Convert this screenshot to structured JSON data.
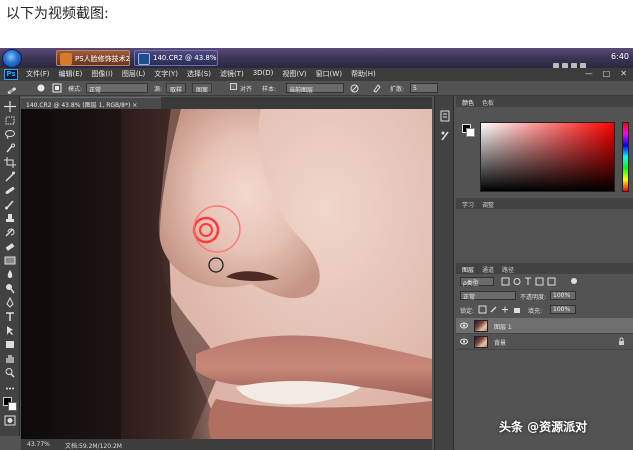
{
  "caption": "以下为视频截图:",
  "taskbar": {
    "tasks": [
      {
        "label": "PS人脸修饰技术2"
      },
      {
        "label": "140.CR2 @ 43.8%"
      }
    ],
    "clock": "6:40"
  },
  "menubar": {
    "logo": "Ps",
    "items": [
      "文件(F)",
      "编辑(E)",
      "图像(I)",
      "图层(L)",
      "文字(Y)",
      "选择(S)",
      "滤镜(T)",
      "3D(D)",
      "视图(V)",
      "窗口(W)",
      "帮助(H)"
    ],
    "controls": [
      "—",
      "□",
      "✕"
    ]
  },
  "options": {
    "mode_label": "模式:",
    "mode_value": "正常",
    "source_label": "源:",
    "sampled_button": "取样",
    "pattern_button": "图案",
    "aligned_label": "对齐",
    "sample_label": "样本:",
    "sample_value": "当前图层",
    "diffusion_label": "扩散:",
    "diffusion_value": "5"
  },
  "document": {
    "tab_title": "140.CR2 @ 43.8% (图层 1, RGB/8*) ×",
    "zoom": "43.77%",
    "doc_info": "文档:59.2M/120.2M"
  },
  "color_panel": {
    "tabs": [
      "颜色",
      "色板"
    ]
  },
  "adjust_panel": {
    "tabs": [
      "学习",
      "调整"
    ]
  },
  "layers_panel": {
    "tabs": [
      "图层",
      "通道",
      "路径"
    ],
    "filter_label": "ρ类型",
    "blend_mode": "正常",
    "opacity_label": "不透明度:",
    "opacity_value": "100%",
    "lock_label": "锁定:",
    "fill_label": "填充:",
    "fill_value": "100%",
    "layers": [
      {
        "name": "图层 1",
        "selected": true,
        "locked": false
      },
      {
        "name": "背景",
        "selected": false,
        "locked": true
      }
    ]
  },
  "watermark": "头条 @资源派对"
}
